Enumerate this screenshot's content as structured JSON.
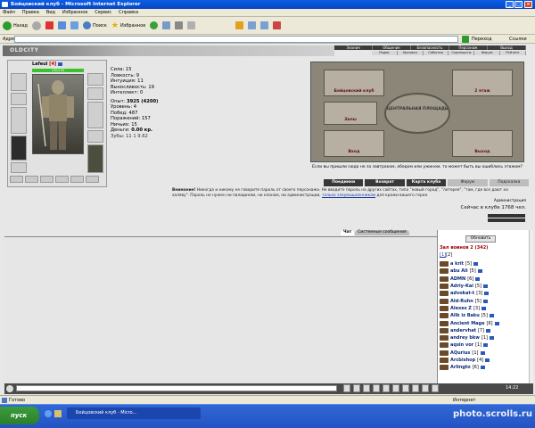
{
  "window": {
    "title": "Бойцовский клуб - Microsoft Internet Explorer"
  },
  "menu": [
    "Файл",
    "Правка",
    "Вид",
    "Избранное",
    "Сервис",
    "Справка"
  ],
  "toolbar": {
    "back": "Назад",
    "search": "Поиск",
    "favorites": "Избранное"
  },
  "address": {
    "label": "Адрес",
    "value": "",
    "go": "Переход",
    "links": "Ссылки"
  },
  "site": {
    "logo": "OLDCITY",
    "nav_main": [
      "Знания",
      "Общение",
      "Безопасность",
      "Персонаж",
      "Выход"
    ],
    "nav_sub": [
      "Радио",
      "Хроники",
      "События",
      "Скриншоты",
      "Форум",
      "Рейтинг"
    ]
  },
  "character": {
    "name": "Lafeul",
    "level": "[4]",
    "hp": "130/130",
    "stats": [
      {
        "label": "Сила:",
        "value": "15"
      },
      {
        "label": "Ловкость:",
        "value": "9"
      },
      {
        "label": "Интуиция:",
        "value": "11"
      },
      {
        "label": "Выносливость:",
        "value": "19"
      },
      {
        "label": "Интеллект:",
        "value": "0"
      }
    ],
    "info": [
      {
        "label": "Опыт:",
        "value": "3925 (4200)"
      },
      {
        "label": "Уровень:",
        "value": "4"
      },
      {
        "label": "Побед:",
        "value": "487"
      },
      {
        "label": "Поражений:",
        "value": "157"
      },
      {
        "label": "Ничьих:",
        "value": "15"
      },
      {
        "label": "Деньги:",
        "value": "0.00 кр."
      }
    ],
    "teeth_label": "Зубы:",
    "teeth": "11 1 9.62"
  },
  "map": {
    "tiles": [
      "Бойцовский клуб",
      "2 этаж",
      "Залы",
      "Вход",
      "Выход"
    ],
    "center": "ЦЕНТРАЛЬНАЯ ПЛОЩАДЬ",
    "caption": "Если вы пришли сюда не за завтраком, обедом или ужином, то может быть вы ошиблись этажом?"
  },
  "buttons": [
    "Поединки",
    "Возврат",
    "Карта клуба",
    "Форум",
    "Подсказка"
  ],
  "warning": {
    "bold": "Внимание!",
    "text": "Никогда и никому не говорите пароль от своего персонажа. Не вводите пароль на других сайтах, типа \"новый город\", \"лотерея\", \"там, где все дают на халяву\". Пароль не нужен ни паладинам, ни кланам, ни администрации,",
    "link": "только злоумышленникам",
    "tail": "для кражи вашего героя.",
    "signature": "Администрация"
  },
  "online": "Сейчас в клубе 1768 чел.",
  "chat": {
    "tabs": [
      "Чат",
      "Системные сообщения"
    ]
  },
  "room": {
    "refresh": "Обновить",
    "title": "Зал воинов 2 (342)",
    "pages": [
      "[1]",
      "[2]"
    ],
    "users": [
      {
        "name": "a krit",
        "level": "[5]"
      },
      {
        "name": "abu Ali",
        "level": "[5]"
      },
      {
        "name": "ADMN",
        "level": "[6]"
      },
      {
        "name": "Adriy-Kai",
        "level": "[5]"
      },
      {
        "name": "advokat-t",
        "level": "[3]"
      },
      {
        "name": "Ald-Ruhn",
        "level": "[5]"
      },
      {
        "name": "Alexes Z",
        "level": "[3]"
      },
      {
        "name": "Alik iz Baku",
        "level": "[5]"
      },
      {
        "name": "Ancient Mage",
        "level": "[6]"
      },
      {
        "name": "andervhat",
        "level": "[7]"
      },
      {
        "name": "andrey bkw",
        "level": "[1]"
      },
      {
        "name": "aqsin vor",
        "level": "[1]"
      },
      {
        "name": "AQurius",
        "level": "[1]"
      },
      {
        "name": "Arcbishop",
        "level": "[4]"
      },
      {
        "name": "Arlingto",
        "level": "[6]"
      }
    ]
  },
  "clock": "14:22",
  "status": {
    "left": "Готово",
    "zone": "Интернет"
  },
  "taskbar": {
    "start": "пуск",
    "item": "Бойцовский клуб - Micro..."
  },
  "watermark": "photo.scrolls.ru",
  "colors": {
    "titlebar": "#0a5ee6",
    "room_title": "#a10000",
    "user_name": "#0a2a7a",
    "hp": "#39c22c"
  }
}
